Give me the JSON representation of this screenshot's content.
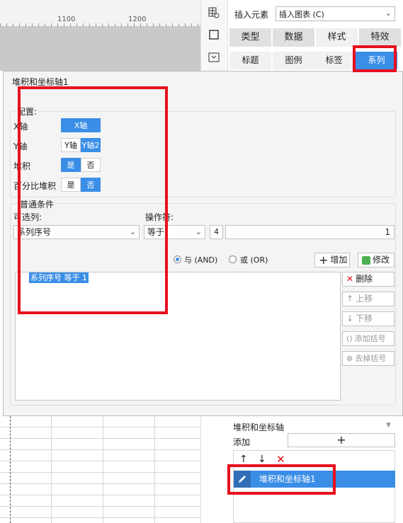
{
  "ruler": {
    "labels": [
      "1100",
      "1200"
    ]
  },
  "toolbar": {
    "insert_label": "插入元素",
    "insert_select": "插入图表 (C)"
  },
  "tabs_primary": [
    "类型",
    "数据",
    "样式",
    "特效"
  ],
  "tabs_secondary": [
    "标题",
    "图例",
    "标签",
    "系列"
  ],
  "dialog": {
    "title": "堆积和坐标轴1",
    "config": {
      "group_label": "配置:",
      "x_axis": {
        "label": "X轴",
        "option": "X轴"
      },
      "y_axis": {
        "label": "Y轴",
        "options": [
          "Y轴",
          "Y轴2"
        ]
      },
      "stack": {
        "label": "堆积",
        "yes": "是",
        "no": "否"
      },
      "percent_stack": {
        "label": "百分比堆积",
        "yes": "是",
        "no": "否"
      }
    },
    "condition": {
      "group_label": "普通条件",
      "column_label": "可选列:",
      "column_value": "系列序号",
      "operator_label": "操作符:",
      "operator_value": "等于",
      "value_type_icon": "4",
      "value": "1",
      "and_label": "与 (AND)",
      "or_label": "或 (OR)",
      "add_button": "增加",
      "modify_button": "修改",
      "delete_button": "删除",
      "up_button": "上移",
      "down_button": "下移",
      "add_paren_button": "添加括号",
      "remove_paren_button": "去掉括号",
      "list_item": "系列序号 等于 1"
    }
  },
  "bottom_panel": {
    "title": "堆积和坐标轴",
    "add_label": "添加",
    "add_symbol": "+",
    "item": "堆积和坐标轴1"
  },
  "colors": {
    "accent": "#3a8ee6",
    "annotation": "#e8101e"
  }
}
